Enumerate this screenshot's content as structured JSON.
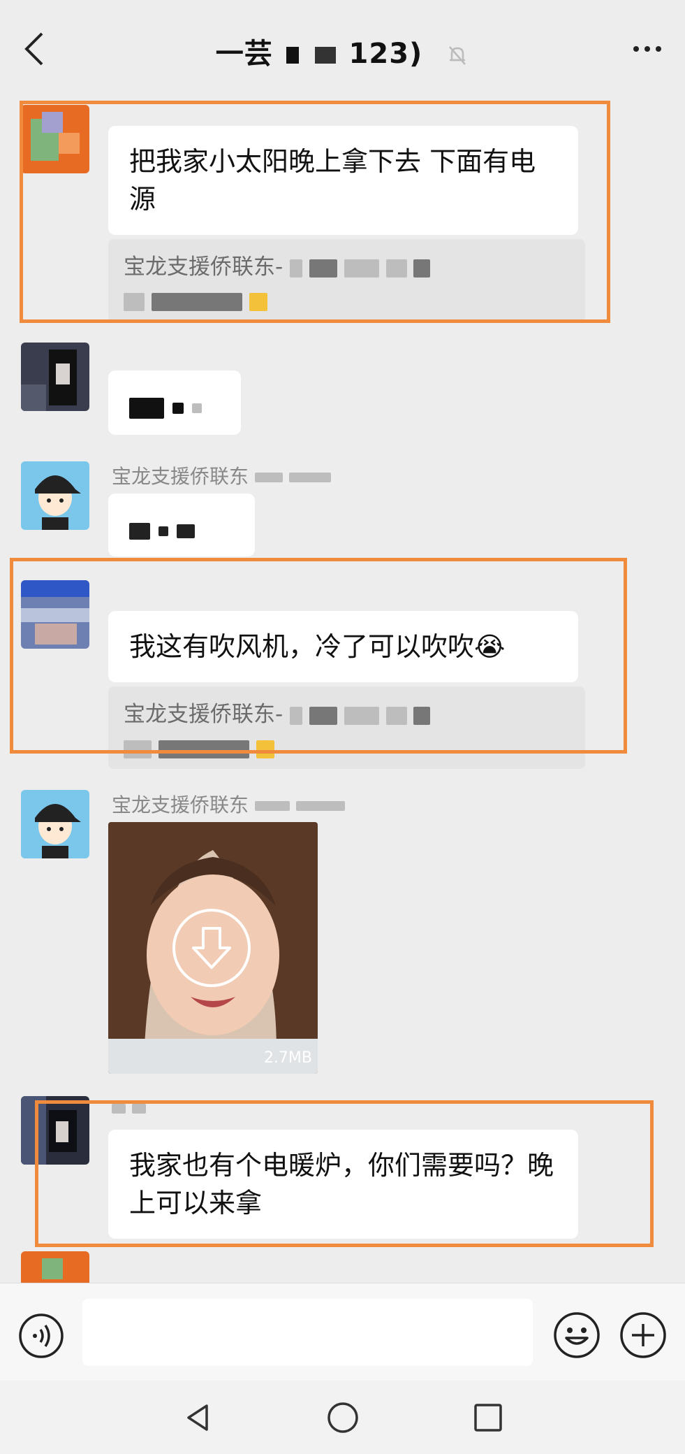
{
  "header": {
    "title_prefix": "一芸",
    "title_suffix": "123)"
  },
  "messages": [
    {
      "text": "把我家小太阳晚上拿下去    下面有电源",
      "quote_author": "宝龙支援侨联东-"
    },
    {
      "text": ""
    },
    {
      "name": "宝龙支援侨联东"
    },
    {
      "text": "我这有吹风机，冷了可以吹吹😭",
      "quote_author": "宝龙支援侨联东-"
    },
    {
      "name": "宝龙支援侨联东",
      "video_size": "2.7MB"
    },
    {
      "text": "我家也有个电暖炉，你们需要吗？晚上可以来拿"
    }
  ],
  "input": {
    "placeholder": ""
  },
  "colors": {
    "highlight": "#f08a3c",
    "background": "#ededed"
  }
}
